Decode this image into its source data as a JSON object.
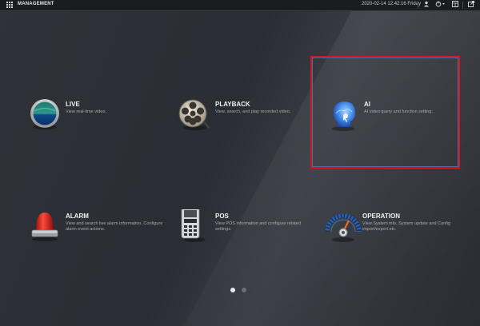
{
  "header": {
    "title": "MANAGEMENT",
    "datetime": "2020-02-14 12:42:16 Friday",
    "icons": [
      "apps-grid-icon",
      "user-icon",
      "power-icon",
      "monitor-icon",
      "external-link-icon"
    ]
  },
  "tiles": [
    {
      "name": "LIVE",
      "desc": "View real-time video.",
      "icon": "live-icon"
    },
    {
      "name": "PLAYBACK",
      "desc": "View, search, and play recorded video.",
      "icon": "film-reel-icon"
    },
    {
      "name": "AI",
      "desc": "AI video query and function setting.",
      "icon": "ai-head-icon"
    },
    {
      "name": "ALARM",
      "desc": "View and search live alarm information. Configure alarm event actions.",
      "icon": "alarm-siren-icon"
    },
    {
      "name": "POS",
      "desc": "View POS information and configure related settings.",
      "icon": "pos-terminal-icon"
    },
    {
      "name": "OPERATION",
      "desc": "View System info, System update and Config import/export etc.",
      "icon": "gauge-icon"
    }
  ],
  "pagination": {
    "pages": 2,
    "current": 1
  },
  "colors": {
    "highlight": "#d2181f",
    "accent_blue": "#4b6f9c"
  }
}
